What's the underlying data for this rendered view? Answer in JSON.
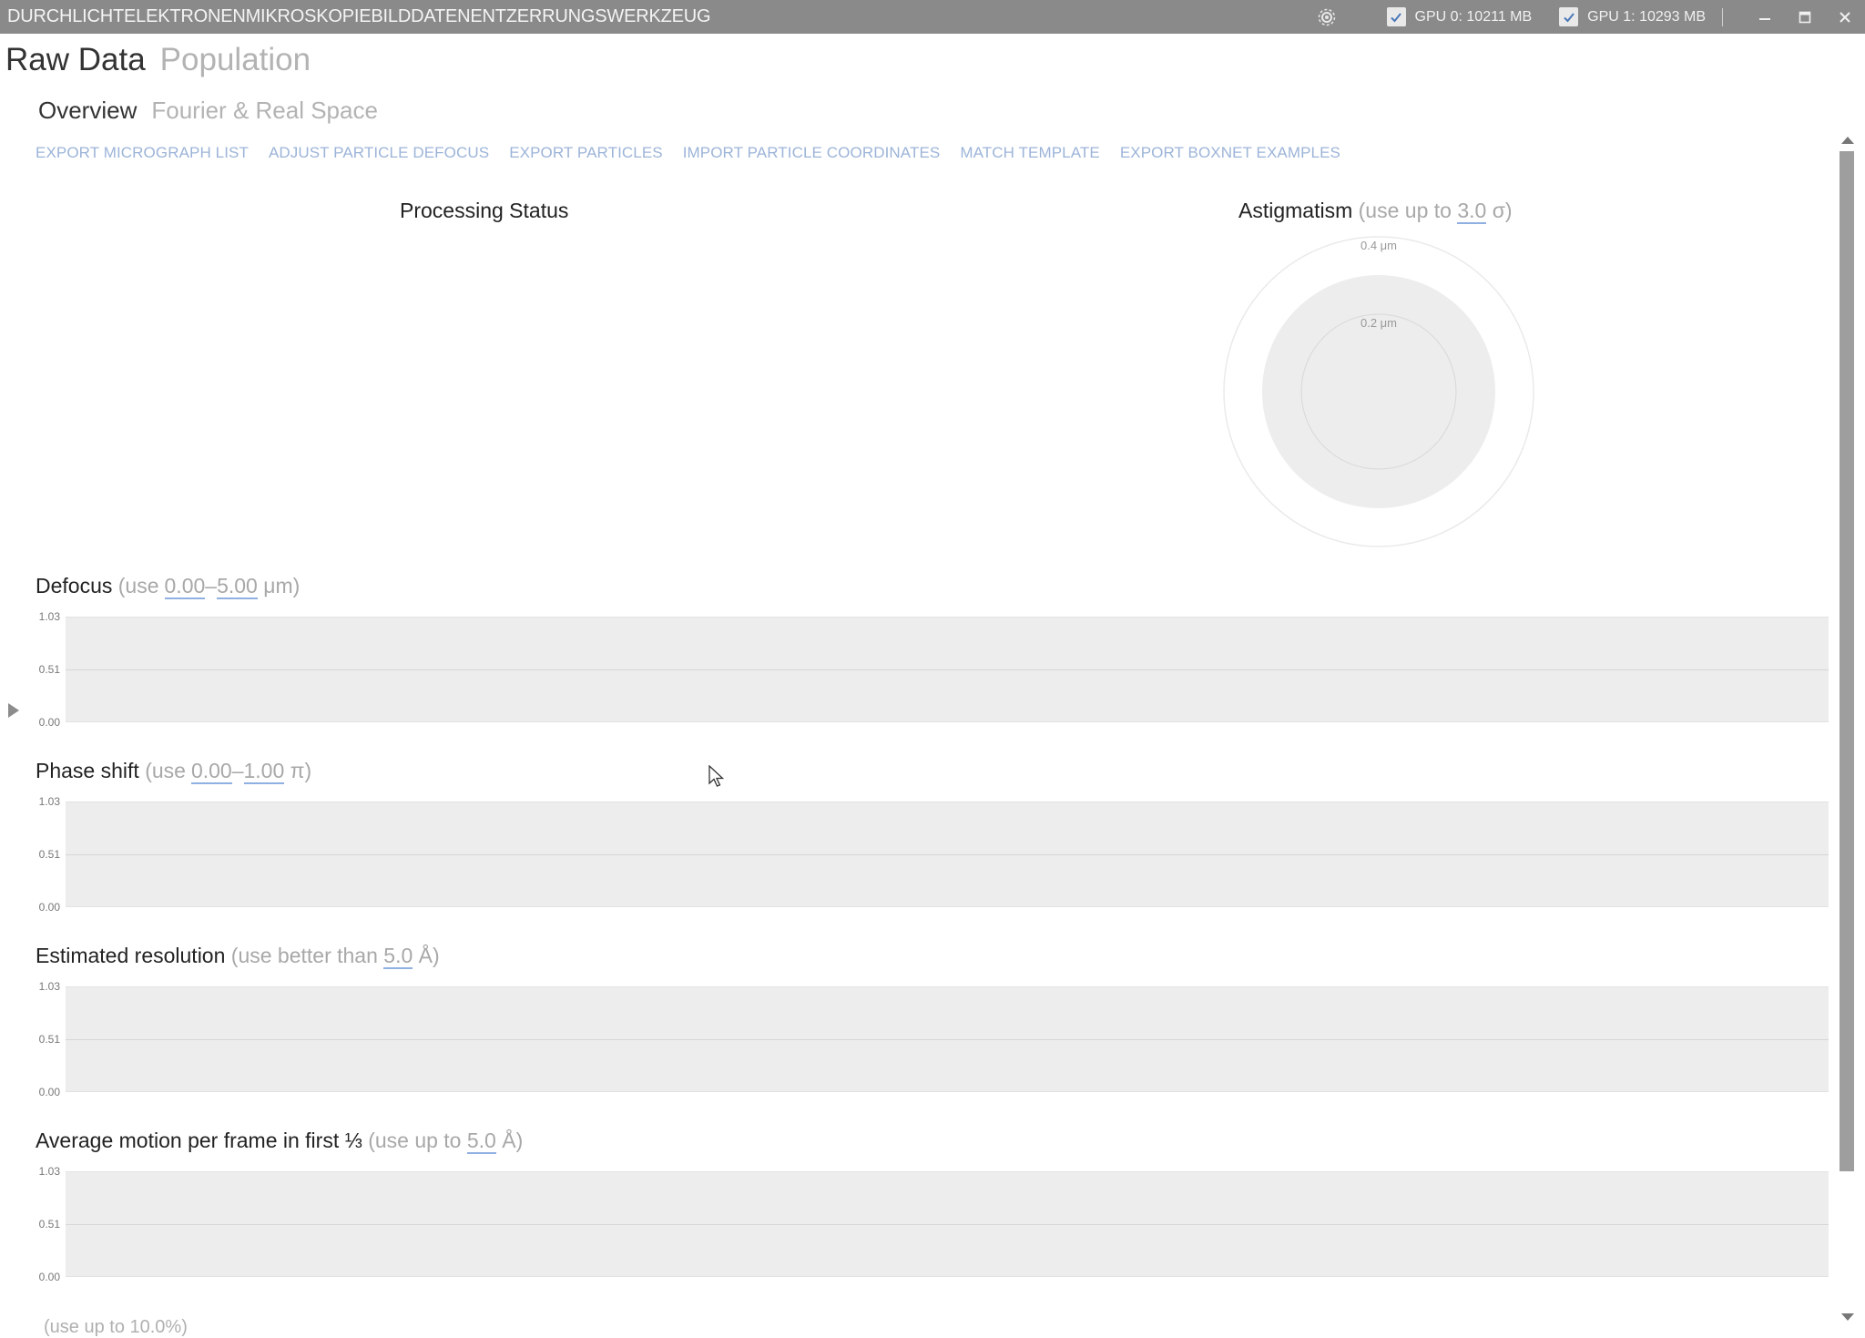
{
  "titlebar": {
    "app_title": "DURCHLICHTELEKTRONENMIKROSKOPIEBILDDATENENTZERRUNGSWERKZEUG",
    "gpu0": "GPU 0: 10211 MB",
    "gpu1": "GPU 1: 10293 MB",
    "icons": [
      "gear-icon",
      "checkbox-checked-icon",
      "minimize-icon",
      "maximize-icon",
      "close-icon"
    ]
  },
  "main_tabs": [
    {
      "label": "Raw Data",
      "active": true
    },
    {
      "label": "Population",
      "active": false
    }
  ],
  "sub_tabs": [
    {
      "label": "Overview",
      "active": true
    },
    {
      "label": "Fourier & Real Space",
      "active": false
    }
  ],
  "actions": [
    "EXPORT MICROGRAPH LIST",
    "ADJUST PARTICLE DEFOCUS",
    "EXPORT PARTICLES",
    "IMPORT PARTICLE COORDINATES",
    "MATCH TEMPLATE",
    "EXPORT BOXNET EXAMPLES"
  ],
  "processing_status": {
    "title": "Processing Status"
  },
  "astigmatism": {
    "title": "Astigmatism",
    "hint_prefix": "(use up to",
    "value": "3.0",
    "hint_suffix": "σ)",
    "outer_ring_label": "0.4 μm",
    "inner_ring_label": "0.2 μm"
  },
  "plots": {
    "defocus": {
      "title": "Defocus",
      "hint_prefix": "(use",
      "min": "0.00",
      "dash": "–",
      "max": "5.00",
      "hint_suffix": "μm)",
      "ticks": [
        "1.03",
        "0.51",
        "0.00"
      ]
    },
    "phase": {
      "title": "Phase shift",
      "hint_prefix": "(use",
      "min": "0.00",
      "dash": "–",
      "max": "1.00",
      "hint_suffix": "π)",
      "ticks": [
        "1.03",
        "0.51",
        "0.00"
      ]
    },
    "resolution": {
      "title": "Estimated resolution",
      "hint_prefix": "(use better than",
      "value": "5.0",
      "hint_suffix": "Å)",
      "ticks": [
        "1.03",
        "0.51",
        "0.00"
      ]
    },
    "motion": {
      "title": "Average motion per frame in first ⅓",
      "hint_prefix": "(use up to",
      "value": "5.0",
      "hint_suffix": "Å)",
      "ticks": [
        "1.03",
        "0.51",
        "0.00"
      ]
    }
  },
  "partial_next": {
    "text": "(use up to 10.0%)"
  }
}
